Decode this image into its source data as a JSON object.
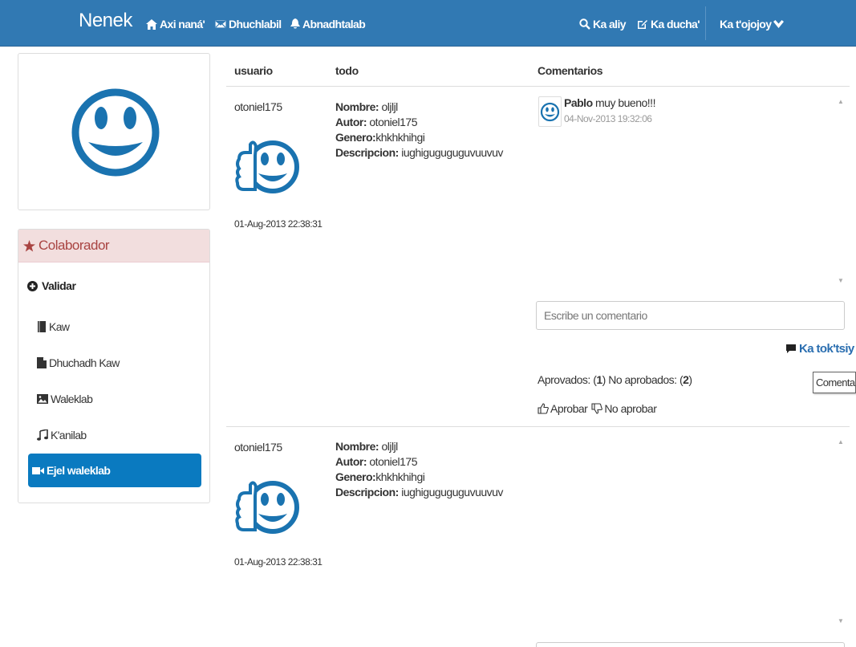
{
  "navbar": {
    "brand": "Nenek",
    "home": "Axi naná'",
    "messages": "Dhuchlabil",
    "notifications": "Abnadhtalab",
    "search": "Ka aliy",
    "write": "Ka ducha'",
    "user_menu": "Ka t'ojojoy"
  },
  "sidebar": {
    "panel_title": "Colaborador",
    "section": "Validar",
    "items": [
      {
        "label": "Kaw",
        "icon": "book-icon"
      },
      {
        "label": "Dhuchadh Kaw",
        "icon": "file-icon"
      },
      {
        "label": "Waleklab",
        "icon": "picture-icon"
      },
      {
        "label": "K'anilab",
        "icon": "music-icon"
      },
      {
        "label": "Ejel waleklab",
        "icon": "video-icon",
        "active": true
      }
    ]
  },
  "table": {
    "headers": [
      "usuario",
      "todo",
      "Comentarios"
    ],
    "rows": [
      {
        "user": "otoniel175",
        "timestamp": "01-Aug-2013 22:38:31",
        "nombre_label": "Nombre:",
        "nombre": " oljljl",
        "autor_label": "Autor:",
        "autor": " otoniel175",
        "genero_label": "Genero:",
        "genero": "khkhkhihgi",
        "descripcion_label": "Descripcion:",
        "descripcion": " iughiguguguguvuuvuv",
        "comments": [
          {
            "author": "Pablo",
            "text": " muy bueno!!!",
            "date": "04-Nov-2013 19:32:06"
          }
        ],
        "comment_placeholder": "Escribe un comentario",
        "send_label": "Ka tok'tsiy",
        "approved_label": "Aprovados: (",
        "approved_count": "1",
        "not_approved_label": ") No aprobados: (",
        "not_approved_count": "2",
        "approve_btn": "Aprobar",
        "disapprove_btn": "No aprobar",
        "tooltip": "Comentar"
      },
      {
        "user": "otoniel175",
        "timestamp": "01-Aug-2013 22:38:31",
        "nombre_label": "Nombre:",
        "nombre": " oljljl",
        "autor_label": "Autor:",
        "autor": " otoniel175",
        "genero_label": "Genero:",
        "genero": "khkhkhihgi",
        "descripcion_label": "Descripcion:",
        "descripcion": " iughiguguguguvuuvuv"
      }
    ]
  },
  "colors": {
    "navbar": "#3179b3",
    "brand_blue": "#1a73b0",
    "panel_heading_bg": "#f2dede",
    "panel_heading_text": "#a94442",
    "active_item": "#0a7ac0",
    "link": "#2a6eb0"
  }
}
